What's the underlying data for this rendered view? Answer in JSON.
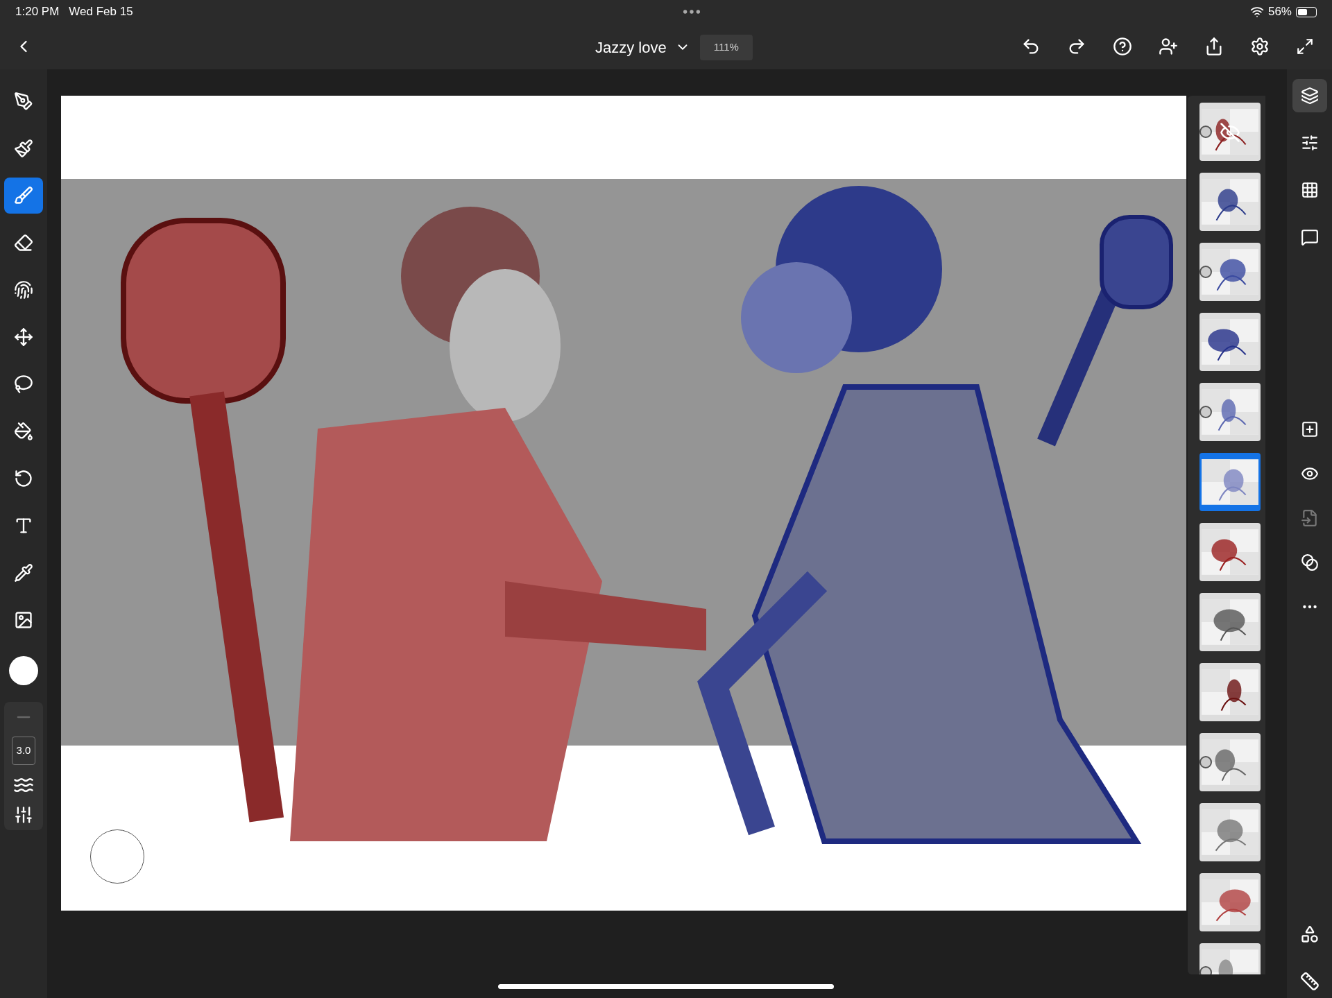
{
  "status_bar": {
    "time": "1:20 PM",
    "date": "Wed Feb 15",
    "battery": "56%"
  },
  "document": {
    "title": "Jazzy love",
    "zoom": "111%"
  },
  "tools": [
    {
      "selected": false
    },
    {
      "selected": false
    },
    {
      "selected": true
    },
    {
      "selected": false
    },
    {
      "selected": false
    },
    {
      "selected": false
    },
    {
      "selected": false
    },
    {
      "selected": false
    },
    {
      "selected": false
    },
    {
      "selected": false
    },
    {
      "selected": false
    },
    {
      "selected": false
    }
  ],
  "brush_size": "3.0",
  "layers": [
    {
      "selected": false,
      "hidden": true,
      "clipped": true
    },
    {
      "selected": false,
      "hidden": false,
      "clipped": false
    },
    {
      "selected": false,
      "hidden": false,
      "clipped": true
    },
    {
      "selected": false,
      "hidden": false,
      "clipped": false
    },
    {
      "selected": false,
      "hidden": false,
      "clipped": true
    },
    {
      "selected": true,
      "hidden": false,
      "clipped": false
    },
    {
      "selected": false,
      "hidden": false,
      "clipped": false
    },
    {
      "selected": false,
      "hidden": false,
      "clipped": false
    },
    {
      "selected": false,
      "hidden": false,
      "clipped": false
    },
    {
      "selected": false,
      "hidden": false,
      "clipped": true
    },
    {
      "selected": false,
      "hidden": false,
      "clipped": false
    },
    {
      "selected": false,
      "hidden": false,
      "clipped": false
    },
    {
      "selected": false,
      "hidden": false,
      "clipped": true
    }
  ],
  "right_tools": [
    {
      "selected": true
    },
    {
      "selected": false
    },
    {
      "selected": false
    },
    {
      "selected": false
    }
  ]
}
